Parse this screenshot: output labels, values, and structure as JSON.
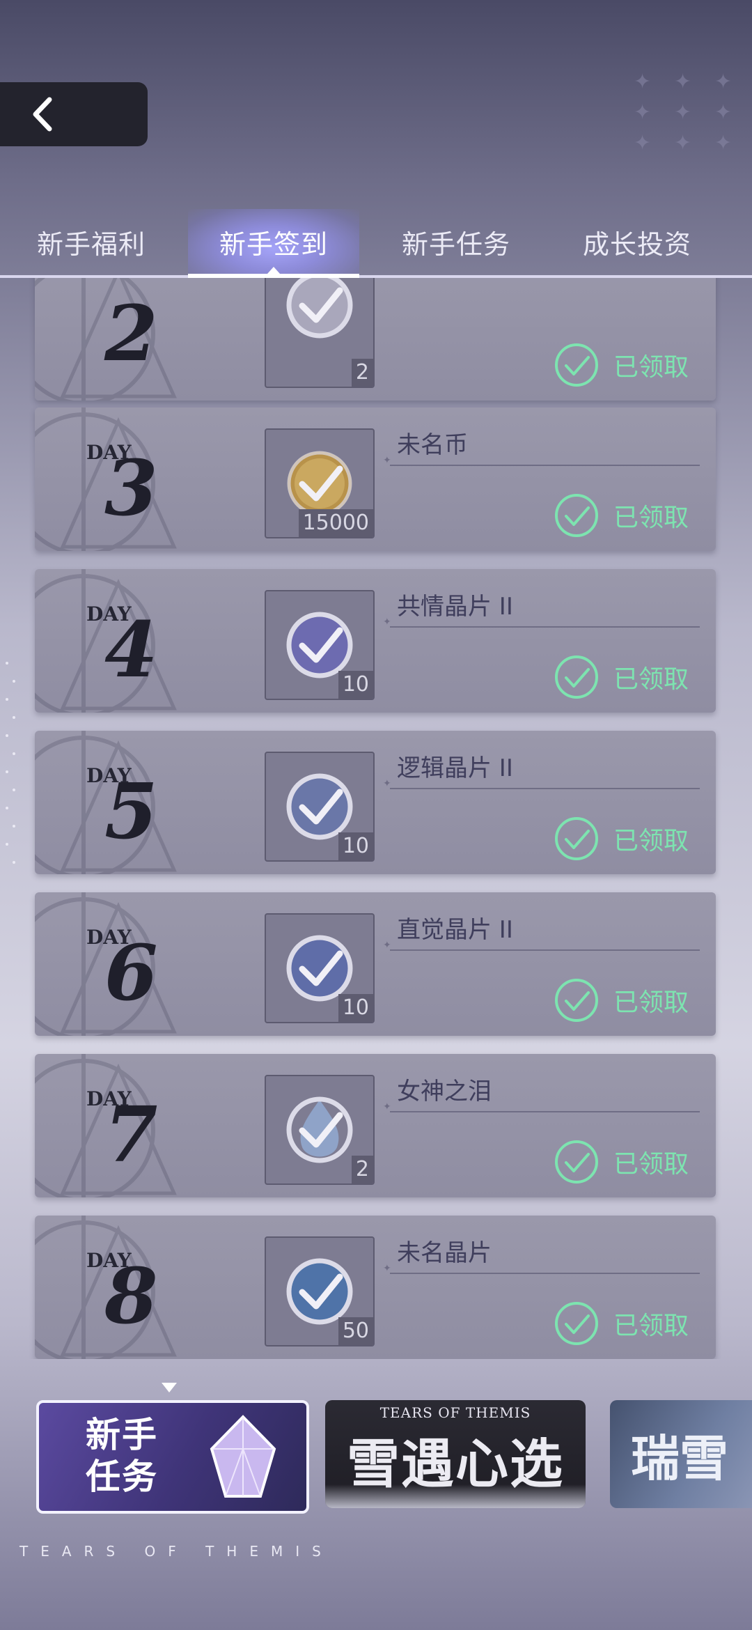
{
  "header": {
    "back_icon": "chevron-left-icon"
  },
  "tabs": [
    {
      "label": "新手福利",
      "active": false
    },
    {
      "label": "新手签到",
      "active": true
    },
    {
      "label": "新手任务",
      "active": false
    },
    {
      "label": "成长投资",
      "active": false
    }
  ],
  "signin": {
    "claimed_label": "已领取",
    "day_prefix": "DAY",
    "days": [
      {
        "day": "2",
        "name": "",
        "qty": "2",
        "icon": "check-item-icon"
      },
      {
        "day": "3",
        "name": "未名币",
        "qty": "15000",
        "icon": "coin-icon"
      },
      {
        "day": "4",
        "name": "共情晶片 II",
        "qty": "10",
        "icon": "crystal-chip-icon"
      },
      {
        "day": "5",
        "name": "逻辑晶片 II",
        "qty": "10",
        "icon": "crystal-chip-icon"
      },
      {
        "day": "6",
        "name": "直觉晶片 II",
        "qty": "10",
        "icon": "crystal-chip-icon"
      },
      {
        "day": "7",
        "name": "女神之泪",
        "qty": "2",
        "icon": "tear-gem-icon"
      },
      {
        "day": "8",
        "name": "未名晶片",
        "qty": "50",
        "icon": "chip-icon"
      }
    ]
  },
  "banners": {
    "b1_line1": "新手",
    "b1_line2": "任务",
    "b2_sub": "TEARS OF THEMIS",
    "b2_title": "雪遇心选",
    "b3_title": "瑞雪"
  },
  "footer": {
    "brand": "TEARS OF THEMIS"
  },
  "colors": {
    "claimed": "#7de4b0",
    "tab_active": "#9896f0"
  }
}
